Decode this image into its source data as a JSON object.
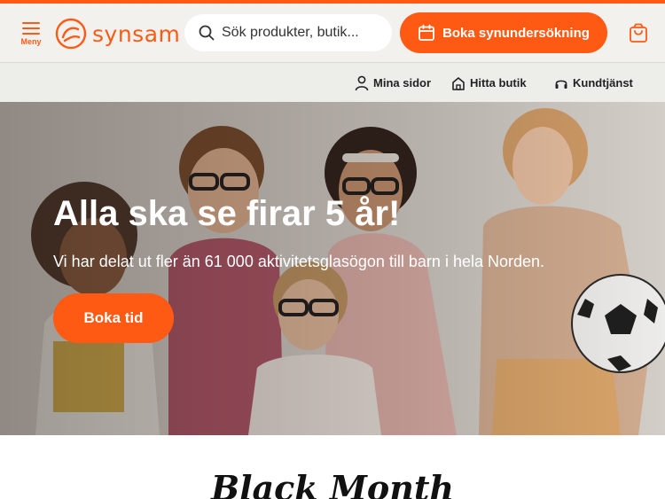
{
  "header": {
    "menu_label": "Meny",
    "logo_text": "synsam",
    "search_placeholder": "Sök produkter, butik...",
    "book_button": "Boka synundersökning"
  },
  "subnav": {
    "items": [
      {
        "label": "Mina sidor",
        "icon": "person-icon"
      },
      {
        "label": "Hitta butik",
        "icon": "store-icon"
      },
      {
        "label": "Kundtjänst",
        "icon": "headset-icon"
      }
    ]
  },
  "hero": {
    "title": "Alla ska se firar 5 år!",
    "subtitle": "Vi har delat ut fler än 61 000 aktivitetsglasögon till barn i hela Norden.",
    "cta": "Boka tid"
  },
  "section": {
    "title": "Black Month"
  },
  "colors": {
    "brand": "#ff5a14",
    "header_bg": "#f3f1ee",
    "subnav_bg": "#ededea"
  }
}
